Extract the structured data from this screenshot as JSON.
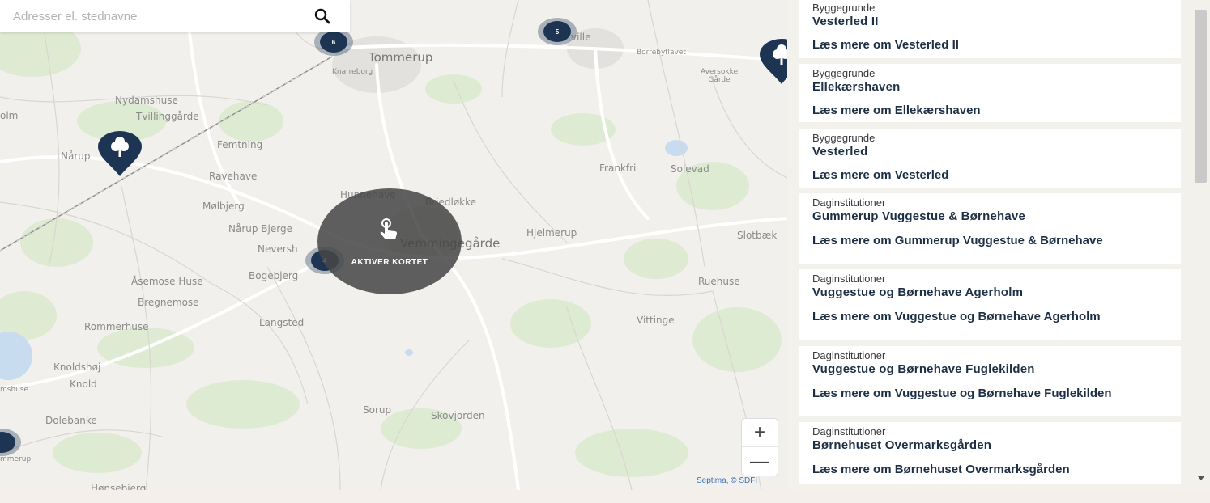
{
  "search": {
    "placeholder": "Adresser el. stednavne",
    "icon": "search-icon"
  },
  "map": {
    "places": [
      "Tommerup",
      "Knarreborg",
      "Borrebyflavet",
      "Aversokke Gårde",
      "Nydamshuse",
      "Tvillinggårde",
      "Femtning",
      "Nårup",
      "Ravehave",
      "Mølbjerg",
      "Nårup Bjerge",
      "Neversh",
      "Bogebjerg",
      "Hunnehave",
      "Briedløkke",
      "Vemmingegårde",
      "Hjelmerup",
      "Frankfri",
      "Solevad",
      "Slotbæk",
      "Ruehuse",
      "Vittinge",
      "Åsemose Huse",
      "Bregnemose",
      "Rommerhuse",
      "Langsted",
      "Knoldshøj",
      "Knold",
      "Dolebanke",
      "Sorup",
      "Skovjorden",
      "Hønsebjerg",
      "olm",
      "mshuse",
      "mmerup",
      "ville"
    ],
    "clusters": [
      "6",
      "5",
      "4"
    ],
    "activate_label": "AKTIVER KORTET",
    "zoom_in": "+",
    "zoom_out": "—",
    "attribution": "Septima, © SDFI",
    "colors": {
      "cluster": "#1d3553",
      "overlay": "#464646",
      "map_bg": "#f2f0ec",
      "road": "#ffffff",
      "green": "#dcead0"
    }
  },
  "results": [
    {
      "category": "Byggegrunde",
      "name": "Vesterled II",
      "more": "Læs mere om Vesterled II"
    },
    {
      "category": "Byggegrunde",
      "name": "Ellekærshaven",
      "more": "Læs mere om Ellekærshaven"
    },
    {
      "category": "Byggegrunde",
      "name": "Vesterled",
      "more": "Læs mere om Vesterled"
    },
    {
      "category": "Daginstitutioner",
      "name": "Gummerup Vuggestue & Børnehave",
      "more": "Læs mere om Gummerup Vuggestue & Børnehave"
    },
    {
      "category": "Daginstitutioner",
      "name": "Vuggestue og Børnehave Agerholm",
      "more": "Læs mere om Vuggestue og Børnehave Agerholm"
    },
    {
      "category": "Daginstitutioner",
      "name": "Vuggestue og Børnehave Fuglekilden",
      "more": "Læs mere om Vuggestue og Børnehave Fuglekilden"
    },
    {
      "category": "Daginstitutioner",
      "name": "Børnehuset Overmarksgården",
      "more": "Læs mere om Børnehuset Overmarksgården"
    }
  ]
}
